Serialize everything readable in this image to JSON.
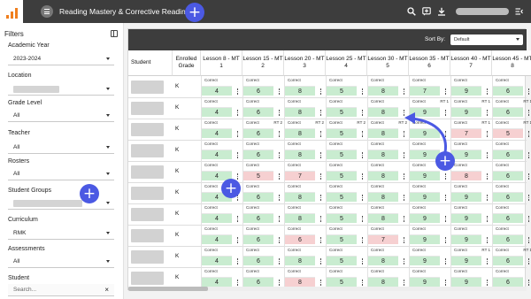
{
  "app": {
    "title": "Reading Mastery & Corrective Reading"
  },
  "topbar": {
    "icons": [
      "search-icon",
      "add-note-icon",
      "download-icon",
      "collapse-menu-icon"
    ],
    "accent": "#f07f1e"
  },
  "sidebar": {
    "title": "Filters",
    "filters": [
      {
        "label": "Academic Year",
        "value": "2023-2024"
      },
      {
        "label": "Location",
        "value": ""
      },
      {
        "label": "Grade Level",
        "value": "All"
      },
      {
        "label": "Teacher",
        "value": "All"
      },
      {
        "label": "Rosters",
        "value": "All"
      },
      {
        "label": "Student Groups",
        "value": ""
      },
      {
        "label": "Curriculum",
        "value": "RMK"
      },
      {
        "label": "Assessments",
        "value": "All"
      }
    ],
    "student_label": "Student",
    "student_placeholder": "Search..."
  },
  "table": {
    "sort_label": "Sort By:",
    "sort_value": "Default",
    "student_header": "Student",
    "grade_header": "Enrolled Grade",
    "lessons": [
      "Lesson 8 - MT 1",
      "Lesson 15 - MT 2",
      "Lesson 20 - MT 3",
      "Lesson 25 - MT 4",
      "Lesson 30 - MT 5",
      "Lesson 35 - MT 6",
      "Lesson 40 - MT 7",
      "Lesson 45 - MT 8"
    ],
    "rows": [
      {
        "grade": "K",
        "cells": [
          {
            "status": "Correct",
            "score": "4",
            "tone": "g",
            "rt": ""
          },
          {
            "status": "Correct",
            "score": "6",
            "tone": "g",
            "rt": ""
          },
          {
            "status": "Correct",
            "score": "8",
            "tone": "g",
            "rt": ""
          },
          {
            "status": "Correct",
            "score": "5",
            "tone": "g",
            "rt": ""
          },
          {
            "status": "Correct",
            "score": "8",
            "tone": "g",
            "rt": ""
          },
          {
            "status": "Correct",
            "score": "7",
            "tone": "g",
            "rt": ""
          },
          {
            "status": "Correct",
            "score": "9",
            "tone": "g",
            "rt": ""
          },
          {
            "status": "Correct",
            "score": "6",
            "tone": "g",
            "rt": ""
          }
        ]
      },
      {
        "grade": "K",
        "cells": [
          {
            "status": "Correct",
            "score": "4",
            "tone": "g",
            "rt": ""
          },
          {
            "status": "Correct",
            "score": "6",
            "tone": "g",
            "rt": ""
          },
          {
            "status": "Correct",
            "score": "8",
            "tone": "g",
            "rt": ""
          },
          {
            "status": "Correct",
            "score": "5",
            "tone": "g",
            "rt": ""
          },
          {
            "status": "Correct",
            "score": "8",
            "tone": "g",
            "rt": ""
          },
          {
            "status": "Correct",
            "score": "9",
            "tone": "g",
            "rt": "RT 1"
          },
          {
            "status": "Correct",
            "score": "9",
            "tone": "g",
            "rt": "RT 1"
          },
          {
            "status": "Correct",
            "score": "6",
            "tone": "g",
            "rt": "RT 1"
          }
        ]
      },
      {
        "grade": "K",
        "cells": [
          {
            "status": "Correct",
            "score": "4",
            "tone": "g",
            "rt": ""
          },
          {
            "status": "Correct",
            "score": "6",
            "tone": "g",
            "rt": "RT 2"
          },
          {
            "status": "Correct",
            "score": "8",
            "tone": "g",
            "rt": "RT 2"
          },
          {
            "status": "Correct",
            "score": "5",
            "tone": "g",
            "rt": "RT 2"
          },
          {
            "status": "Correct",
            "score": "8",
            "tone": "g",
            "rt": "RT 2"
          },
          {
            "status": "Correct",
            "score": "9",
            "tone": "g",
            "rt": ""
          },
          {
            "status": "Correct",
            "score": "7",
            "tone": "r",
            "rt": "RT 1"
          },
          {
            "status": "Correct",
            "score": "5",
            "tone": "r",
            "rt": "RT 1"
          }
        ]
      },
      {
        "grade": "K",
        "cells": [
          {
            "status": "Correct",
            "score": "4",
            "tone": "g",
            "rt": ""
          },
          {
            "status": "Correct",
            "score": "6",
            "tone": "g",
            "rt": ""
          },
          {
            "status": "Correct",
            "score": "8",
            "tone": "g",
            "rt": ""
          },
          {
            "status": "Correct",
            "score": "5",
            "tone": "g",
            "rt": ""
          },
          {
            "status": "Correct",
            "score": "8",
            "tone": "g",
            "rt": ""
          },
          {
            "status": "Correct",
            "score": "9",
            "tone": "g",
            "rt": ""
          },
          {
            "status": "Correct",
            "score": "9",
            "tone": "g",
            "rt": ""
          },
          {
            "status": "Correct",
            "score": "6",
            "tone": "g",
            "rt": ""
          }
        ]
      },
      {
        "grade": "K",
        "cells": [
          {
            "status": "Correct",
            "score": "4",
            "tone": "g",
            "rt": ""
          },
          {
            "status": "Correct",
            "score": "5",
            "tone": "r",
            "rt": ""
          },
          {
            "status": "Correct",
            "score": "7",
            "tone": "r",
            "rt": ""
          },
          {
            "status": "Correct",
            "score": "5",
            "tone": "g",
            "rt": ""
          },
          {
            "status": "Correct",
            "score": "8",
            "tone": "g",
            "rt": ""
          },
          {
            "status": "Correct",
            "score": "9",
            "tone": "g",
            "rt": ""
          },
          {
            "status": "Correct",
            "score": "8",
            "tone": "r",
            "rt": ""
          },
          {
            "status": "Correct",
            "score": "6",
            "tone": "g",
            "rt": ""
          }
        ]
      },
      {
        "grade": "K",
        "cells": [
          {
            "status": "Correct",
            "score": "4",
            "tone": "g",
            "rt": ""
          },
          {
            "status": "Correct",
            "score": "6",
            "tone": "g",
            "rt": ""
          },
          {
            "status": "Correct",
            "score": "8",
            "tone": "g",
            "rt": ""
          },
          {
            "status": "Correct",
            "score": "5",
            "tone": "g",
            "rt": ""
          },
          {
            "status": "Correct",
            "score": "8",
            "tone": "g",
            "rt": ""
          },
          {
            "status": "Correct",
            "score": "9",
            "tone": "g",
            "rt": ""
          },
          {
            "status": "Correct",
            "score": "9",
            "tone": "g",
            "rt": ""
          },
          {
            "status": "Correct",
            "score": "6",
            "tone": "g",
            "rt": ""
          }
        ]
      },
      {
        "grade": "K",
        "cells": [
          {
            "status": "Correct",
            "score": "4",
            "tone": "g",
            "rt": ""
          },
          {
            "status": "Correct",
            "score": "6",
            "tone": "g",
            "rt": ""
          },
          {
            "status": "Correct",
            "score": "8",
            "tone": "g",
            "rt": ""
          },
          {
            "status": "Correct",
            "score": "5",
            "tone": "g",
            "rt": ""
          },
          {
            "status": "Correct",
            "score": "8",
            "tone": "g",
            "rt": ""
          },
          {
            "status": "Correct",
            "score": "9",
            "tone": "g",
            "rt": ""
          },
          {
            "status": "Correct",
            "score": "9",
            "tone": "g",
            "rt": ""
          },
          {
            "status": "Correct",
            "score": "6",
            "tone": "g",
            "rt": ""
          }
        ]
      },
      {
        "grade": "K",
        "cells": [
          {
            "status": "Correct",
            "score": "4",
            "tone": "g",
            "rt": ""
          },
          {
            "status": "Correct",
            "score": "6",
            "tone": "g",
            "rt": ""
          },
          {
            "status": "Correct",
            "score": "6",
            "tone": "r",
            "rt": ""
          },
          {
            "status": "Correct",
            "score": "5",
            "tone": "g",
            "rt": ""
          },
          {
            "status": "Correct",
            "score": "7",
            "tone": "r",
            "rt": ""
          },
          {
            "status": "Correct",
            "score": "9",
            "tone": "g",
            "rt": ""
          },
          {
            "status": "Correct",
            "score": "9",
            "tone": "g",
            "rt": ""
          },
          {
            "status": "Correct",
            "score": "6",
            "tone": "g",
            "rt": ""
          }
        ]
      },
      {
        "grade": "K",
        "cells": [
          {
            "status": "Correct",
            "score": "4",
            "tone": "g",
            "rt": ""
          },
          {
            "status": "Correct",
            "score": "6",
            "tone": "g",
            "rt": ""
          },
          {
            "status": "Correct",
            "score": "8",
            "tone": "g",
            "rt": ""
          },
          {
            "status": "Correct",
            "score": "5",
            "tone": "g",
            "rt": ""
          },
          {
            "status": "Correct",
            "score": "8",
            "tone": "g",
            "rt": ""
          },
          {
            "status": "Correct",
            "score": "9",
            "tone": "g",
            "rt": ""
          },
          {
            "status": "Correct",
            "score": "9",
            "tone": "g",
            "rt": "RT 1"
          },
          {
            "status": "Correct",
            "score": "6",
            "tone": "g",
            "rt": "RT 1"
          }
        ]
      },
      {
        "grade": "K",
        "cells": [
          {
            "status": "Correct",
            "score": "4",
            "tone": "g",
            "rt": ""
          },
          {
            "status": "Correct",
            "score": "6",
            "tone": "g",
            "rt": ""
          },
          {
            "status": "Correct",
            "score": "8",
            "tone": "r",
            "rt": ""
          },
          {
            "status": "Correct",
            "score": "5",
            "tone": "g",
            "rt": ""
          },
          {
            "status": "Correct",
            "score": "8",
            "tone": "g",
            "rt": ""
          },
          {
            "status": "Correct",
            "score": "9",
            "tone": "g",
            "rt": ""
          },
          {
            "status": "Correct",
            "score": "9",
            "tone": "g",
            "rt": ""
          },
          {
            "status": "Correct",
            "score": "6",
            "tone": "g",
            "rt": ""
          }
        ]
      }
    ]
  }
}
